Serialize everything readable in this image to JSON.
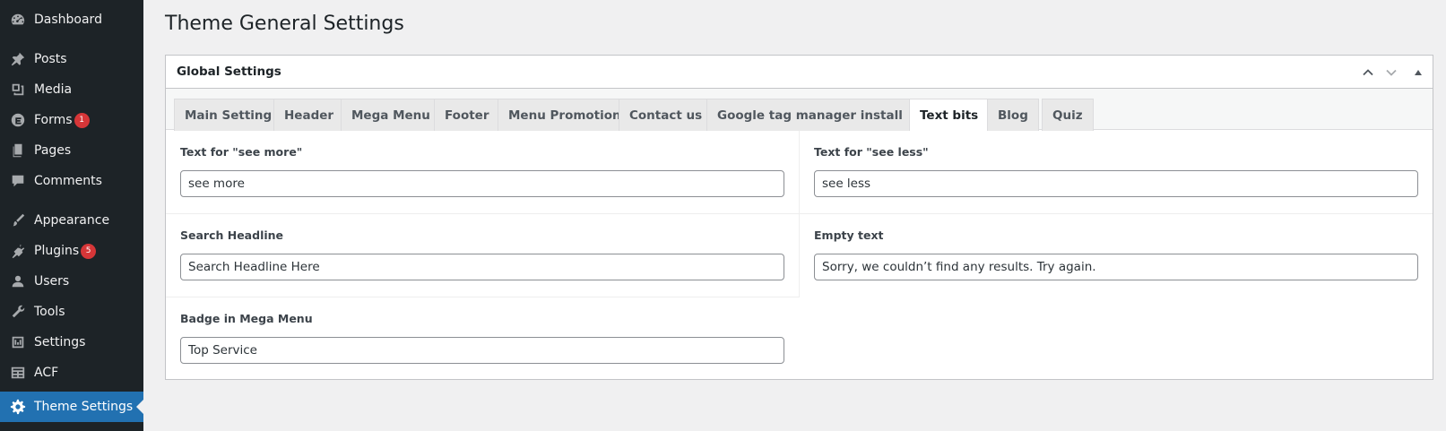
{
  "sidebar": {
    "items": [
      {
        "label": "Dashboard",
        "icon": "dashboard-icon"
      },
      {
        "label": "Posts",
        "icon": "pin-icon"
      },
      {
        "label": "Media",
        "icon": "media-icon"
      },
      {
        "label": "Forms",
        "icon": "forms-icon",
        "badge": "1"
      },
      {
        "label": "Pages",
        "icon": "pages-icon"
      },
      {
        "label": "Comments",
        "icon": "comments-icon"
      },
      {
        "label": "Appearance",
        "icon": "paintbrush-icon"
      },
      {
        "label": "Plugins",
        "icon": "plugins-icon",
        "badge": "5"
      },
      {
        "label": "Users",
        "icon": "users-icon"
      },
      {
        "label": "Tools",
        "icon": "wrench-icon"
      },
      {
        "label": "Settings",
        "icon": "settings-sliders-icon"
      },
      {
        "label": "ACF",
        "icon": "table-icon"
      },
      {
        "label": "Theme Settings",
        "icon": "gear-icon",
        "active": true
      }
    ]
  },
  "page": {
    "title": "Theme General Settings"
  },
  "panel": {
    "title": "Global Settings",
    "tabs": [
      "Main Setting",
      "Header",
      "Mega Menu",
      "Footer",
      "Menu Promotion",
      "Contact us",
      "Google tag manager install",
      "Text bits",
      "Blog",
      "Quiz"
    ],
    "active_tab": "Text bits",
    "fields": {
      "see_more": {
        "label": "Text for \"see more\"",
        "value": "see more"
      },
      "see_less": {
        "label": "Text for \"see less\"",
        "value": "see less"
      },
      "search_headline": {
        "label": "Search Headline",
        "value": "Search Headline Here"
      },
      "empty_text": {
        "label": "Empty text",
        "value": "Sorry, we couldn’t find any results. Try again."
      },
      "badge_mega_menu": {
        "label": "Badge in Mega Menu",
        "value": "Top Service"
      }
    }
  },
  "colors": {
    "sidebar_bg": "#1d2327",
    "active_bg": "#2271b1",
    "badge_bg": "#d63638",
    "page_bg": "#f0f0f1"
  }
}
